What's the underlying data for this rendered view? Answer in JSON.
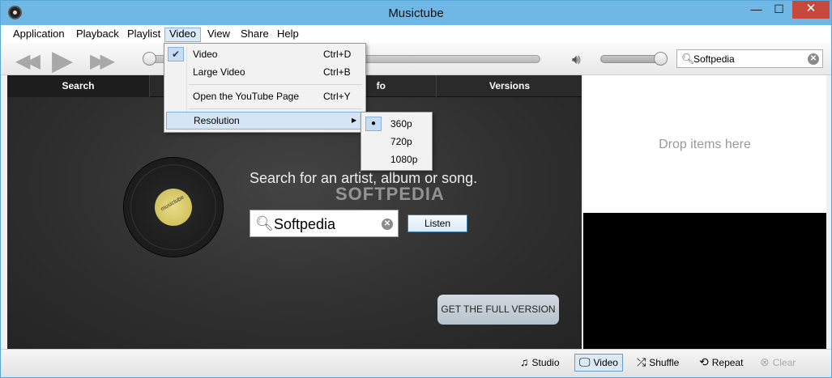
{
  "window": {
    "title": "Musictube",
    "minimize_glyph": "—",
    "maximize_glyph": "☐",
    "close_glyph": "✕"
  },
  "menu": {
    "items": [
      "Application",
      "Playback",
      "Playlist",
      "Video",
      "View",
      "Share",
      "Help"
    ],
    "active": "Video"
  },
  "toolbar": {
    "search_value": "Softpedia"
  },
  "tabs": [
    {
      "label": "Search"
    },
    {
      "label": ""
    },
    {
      "label": "fo"
    },
    {
      "label": "Versions"
    }
  ],
  "main": {
    "heading": "Search for an artist, album or song.",
    "search_value": "Softpedia",
    "listen_label": "Listen",
    "full_version_label": "GET THE FULL VERSION",
    "vinyl_label": "musictube",
    "watermark": "SOFTPEDIA"
  },
  "drop_panel": {
    "text": "Drop items here"
  },
  "video_menu": {
    "items": [
      {
        "label": "Video",
        "shortcut": "Ctrl+D",
        "checked": true
      },
      {
        "label": "Large Video",
        "shortcut": "Ctrl+B",
        "checked": false
      },
      {
        "label": "Open the YouTube Page",
        "shortcut": "Ctrl+Y",
        "checked": false
      },
      {
        "label": "Resolution",
        "shortcut": "",
        "submenu": true
      }
    ],
    "check_glyph": "✔",
    "submenu_arrow": "▶"
  },
  "resolution_menu": {
    "options": [
      "360p",
      "720p",
      "1080p"
    ],
    "selected": "360p",
    "radio_glyph": "●"
  },
  "statusbar": {
    "studio": "Studio",
    "video": "Video",
    "shuffle": "Shuffle",
    "repeat": "Repeat",
    "clear": "Clear"
  },
  "icons": {
    "rewind": "rewind-icon",
    "play": "play-icon",
    "fast_forward": "fast-forward-icon",
    "volume": "volume-icon",
    "search": "search-icon",
    "clear": "clear-icon",
    "studio": "music-note-icon",
    "video": "monitor-icon",
    "shuffle": "shuffle-icon",
    "repeat": "repeat-icon",
    "clear_playlist": "clear-circle-icon"
  },
  "colors": {
    "titlebar": "#6fb8e6",
    "close_button": "#c7483d",
    "menu_highlight": "#d5e5f6",
    "accent_border": "#7fb0e3"
  }
}
